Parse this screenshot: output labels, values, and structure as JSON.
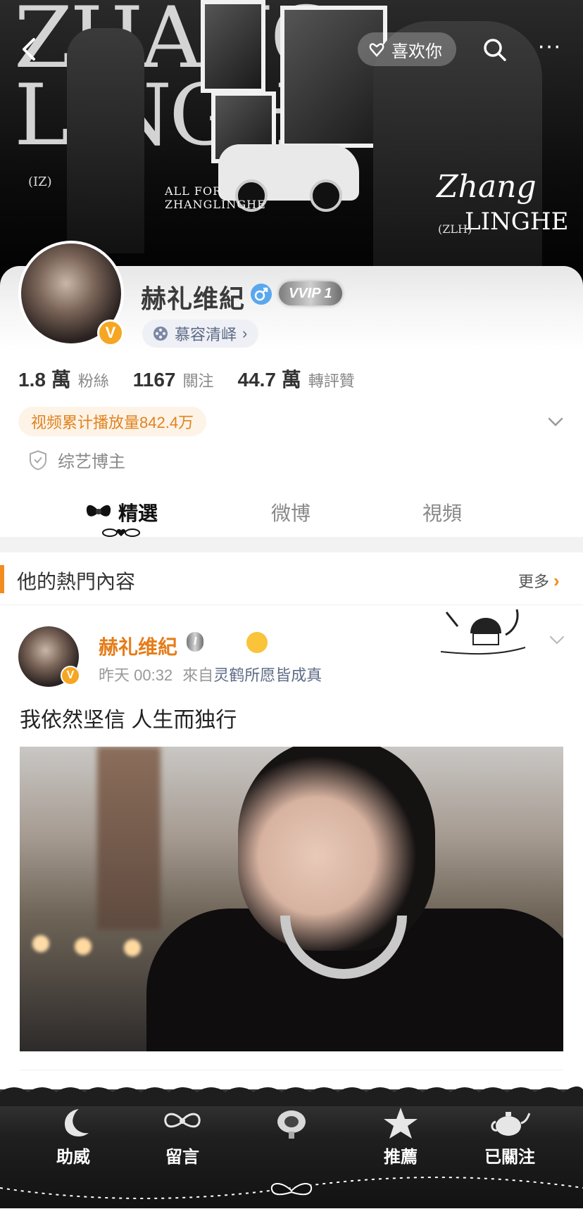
{
  "header": {
    "like_label": "喜欢你",
    "banner_text": {
      "letters": "ZHANG LINGHE",
      "caption_line1": "ALL FOR",
      "caption_line2": "ZHANGLINGHE",
      "script_top": "Zhang",
      "script_bottom": "LINGHE",
      "tag_left": "(IZ)",
      "tag_right": "(ZLH)"
    }
  },
  "profile": {
    "name": "赫礼维紀",
    "vip_label": "VVIP 1",
    "group_label": "慕容清峄",
    "stats": [
      {
        "num": "1.8 萬",
        "label": "粉絲"
      },
      {
        "num": "1167",
        "label": "關注"
      },
      {
        "num": "44.7 萬",
        "label": "轉評贊"
      }
    ],
    "views_text": "视频累计播放量842.4万",
    "role_text": "综艺博主",
    "verified_mark": "V"
  },
  "tabs": [
    {
      "label": "精選",
      "active": true
    },
    {
      "label": "微博",
      "active": false
    },
    {
      "label": "視頻",
      "active": false
    }
  ],
  "hot": {
    "title": "他的熱門內容",
    "more_label": "更多"
  },
  "post": {
    "author": "赫礼维紀",
    "vip_label": "I",
    "time": "昨天 00:32",
    "source_prefix": "來自",
    "source": "灵鹤所愿皆成真",
    "text": "我依然坚信 人生而独行"
  },
  "bottom_bar": [
    {
      "label": "助威",
      "icon": "moon-icon"
    },
    {
      "label": "留言",
      "icon": "ribbon-icon"
    },
    {
      "label": "",
      "icon": "candy-icon"
    },
    {
      "label": "推薦",
      "icon": "star-icon"
    },
    {
      "label": "已關注",
      "icon": "teapot-icon"
    }
  ],
  "colors": {
    "accent": "#f28c1e",
    "link": "#5d6b86",
    "verified": "#f5a623"
  }
}
